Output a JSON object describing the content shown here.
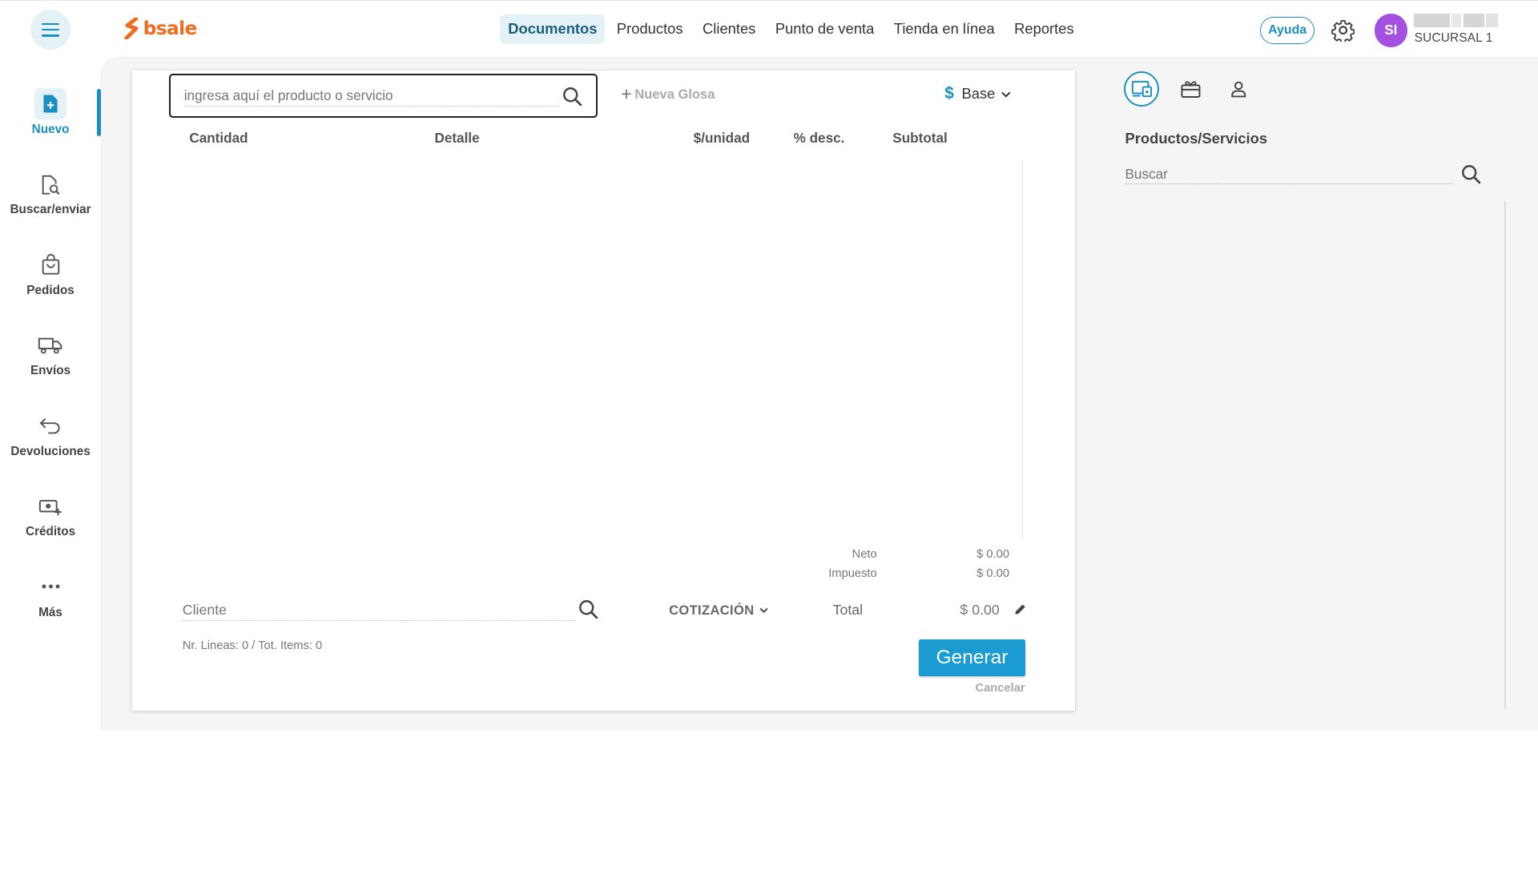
{
  "brand": {
    "name": "bsale",
    "color": "#f26b21"
  },
  "accent": "#1b8fc4",
  "nav": {
    "items": [
      {
        "label": "Documentos",
        "active": true
      },
      {
        "label": "Productos"
      },
      {
        "label": "Clientes"
      },
      {
        "label": "Punto de venta"
      },
      {
        "label": "Tienda en línea"
      },
      {
        "label": "Reportes"
      }
    ]
  },
  "header": {
    "help_label": "Ayuda",
    "avatar_initials": "SI",
    "branch": "SUCURSAL 1"
  },
  "sidebar": {
    "items": [
      {
        "label": "Nuevo",
        "icon": "new-document-icon",
        "active": true
      },
      {
        "label": "Buscar/enviar",
        "icon": "search-document-icon"
      },
      {
        "label": "Pedidos",
        "icon": "shopping-bag-icon"
      },
      {
        "label": "Envíos",
        "icon": "truck-icon"
      },
      {
        "label": "Devoluciones",
        "icon": "return-arrow-icon"
      },
      {
        "label": "Créditos",
        "icon": "credit-cash-icon"
      },
      {
        "label": "Más",
        "icon": "more-dots-icon"
      }
    ]
  },
  "document": {
    "product_search_placeholder": "ingresa aquí el producto o servicio",
    "new_gloss_label": "Nueva Glosa",
    "price_list": {
      "symbol": "$",
      "label": "Base"
    },
    "columns": [
      "Cantidad",
      "Detalle",
      "$/unidad",
      "% desc.",
      "Subtotal"
    ],
    "summary": {
      "neto_label": "Neto",
      "neto_value": "$ 0.00",
      "impuesto_label": "Impuesto",
      "impuesto_value": "$ 0.00",
      "total_label": "Total",
      "total_value": "$ 0.00"
    },
    "client_placeholder": "Cliente",
    "doc_type": "COTIZACIÓN",
    "lines_info": "Nr. Lineas: 0 / Tot. Items: 0",
    "generate_label": "Generar",
    "cancel_label": "Cancelar"
  },
  "right_panel": {
    "title": "Productos/Servicios",
    "search_placeholder": "Buscar",
    "tabs": [
      {
        "icon": "products-devices-icon",
        "active": true
      },
      {
        "icon": "gift-card-icon"
      },
      {
        "icon": "user-icon"
      }
    ]
  }
}
